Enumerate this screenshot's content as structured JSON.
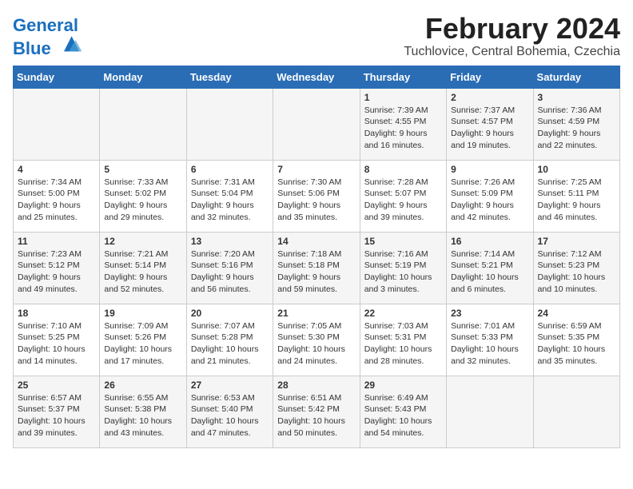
{
  "header": {
    "logo_line1": "General",
    "logo_line2": "Blue",
    "month_year": "February 2024",
    "location": "Tuchlovice, Central Bohemia, Czechia"
  },
  "days_of_week": [
    "Sunday",
    "Monday",
    "Tuesday",
    "Wednesday",
    "Thursday",
    "Friday",
    "Saturday"
  ],
  "weeks": [
    [
      {
        "day": "",
        "info": ""
      },
      {
        "day": "",
        "info": ""
      },
      {
        "day": "",
        "info": ""
      },
      {
        "day": "",
        "info": ""
      },
      {
        "day": "1",
        "info": "Sunrise: 7:39 AM\nSunset: 4:55 PM\nDaylight: 9 hours\nand 16 minutes."
      },
      {
        "day": "2",
        "info": "Sunrise: 7:37 AM\nSunset: 4:57 PM\nDaylight: 9 hours\nand 19 minutes."
      },
      {
        "day": "3",
        "info": "Sunrise: 7:36 AM\nSunset: 4:59 PM\nDaylight: 9 hours\nand 22 minutes."
      }
    ],
    [
      {
        "day": "4",
        "info": "Sunrise: 7:34 AM\nSunset: 5:00 PM\nDaylight: 9 hours\nand 25 minutes."
      },
      {
        "day": "5",
        "info": "Sunrise: 7:33 AM\nSunset: 5:02 PM\nDaylight: 9 hours\nand 29 minutes."
      },
      {
        "day": "6",
        "info": "Sunrise: 7:31 AM\nSunset: 5:04 PM\nDaylight: 9 hours\nand 32 minutes."
      },
      {
        "day": "7",
        "info": "Sunrise: 7:30 AM\nSunset: 5:06 PM\nDaylight: 9 hours\nand 35 minutes."
      },
      {
        "day": "8",
        "info": "Sunrise: 7:28 AM\nSunset: 5:07 PM\nDaylight: 9 hours\nand 39 minutes."
      },
      {
        "day": "9",
        "info": "Sunrise: 7:26 AM\nSunset: 5:09 PM\nDaylight: 9 hours\nand 42 minutes."
      },
      {
        "day": "10",
        "info": "Sunrise: 7:25 AM\nSunset: 5:11 PM\nDaylight: 9 hours\nand 46 minutes."
      }
    ],
    [
      {
        "day": "11",
        "info": "Sunrise: 7:23 AM\nSunset: 5:12 PM\nDaylight: 9 hours\nand 49 minutes."
      },
      {
        "day": "12",
        "info": "Sunrise: 7:21 AM\nSunset: 5:14 PM\nDaylight: 9 hours\nand 52 minutes."
      },
      {
        "day": "13",
        "info": "Sunrise: 7:20 AM\nSunset: 5:16 PM\nDaylight: 9 hours\nand 56 minutes."
      },
      {
        "day": "14",
        "info": "Sunrise: 7:18 AM\nSunset: 5:18 PM\nDaylight: 9 hours\nand 59 minutes."
      },
      {
        "day": "15",
        "info": "Sunrise: 7:16 AM\nSunset: 5:19 PM\nDaylight: 10 hours\nand 3 minutes."
      },
      {
        "day": "16",
        "info": "Sunrise: 7:14 AM\nSunset: 5:21 PM\nDaylight: 10 hours\nand 6 minutes."
      },
      {
        "day": "17",
        "info": "Sunrise: 7:12 AM\nSunset: 5:23 PM\nDaylight: 10 hours\nand 10 minutes."
      }
    ],
    [
      {
        "day": "18",
        "info": "Sunrise: 7:10 AM\nSunset: 5:25 PM\nDaylight: 10 hours\nand 14 minutes."
      },
      {
        "day": "19",
        "info": "Sunrise: 7:09 AM\nSunset: 5:26 PM\nDaylight: 10 hours\nand 17 minutes."
      },
      {
        "day": "20",
        "info": "Sunrise: 7:07 AM\nSunset: 5:28 PM\nDaylight: 10 hours\nand 21 minutes."
      },
      {
        "day": "21",
        "info": "Sunrise: 7:05 AM\nSunset: 5:30 PM\nDaylight: 10 hours\nand 24 minutes."
      },
      {
        "day": "22",
        "info": "Sunrise: 7:03 AM\nSunset: 5:31 PM\nDaylight: 10 hours\nand 28 minutes."
      },
      {
        "day": "23",
        "info": "Sunrise: 7:01 AM\nSunset: 5:33 PM\nDaylight: 10 hours\nand 32 minutes."
      },
      {
        "day": "24",
        "info": "Sunrise: 6:59 AM\nSunset: 5:35 PM\nDaylight: 10 hours\nand 35 minutes."
      }
    ],
    [
      {
        "day": "25",
        "info": "Sunrise: 6:57 AM\nSunset: 5:37 PM\nDaylight: 10 hours\nand 39 minutes."
      },
      {
        "day": "26",
        "info": "Sunrise: 6:55 AM\nSunset: 5:38 PM\nDaylight: 10 hours\nand 43 minutes."
      },
      {
        "day": "27",
        "info": "Sunrise: 6:53 AM\nSunset: 5:40 PM\nDaylight: 10 hours\nand 47 minutes."
      },
      {
        "day": "28",
        "info": "Sunrise: 6:51 AM\nSunset: 5:42 PM\nDaylight: 10 hours\nand 50 minutes."
      },
      {
        "day": "29",
        "info": "Sunrise: 6:49 AM\nSunset: 5:43 PM\nDaylight: 10 hours\nand 54 minutes."
      },
      {
        "day": "",
        "info": ""
      },
      {
        "day": "",
        "info": ""
      }
    ]
  ]
}
